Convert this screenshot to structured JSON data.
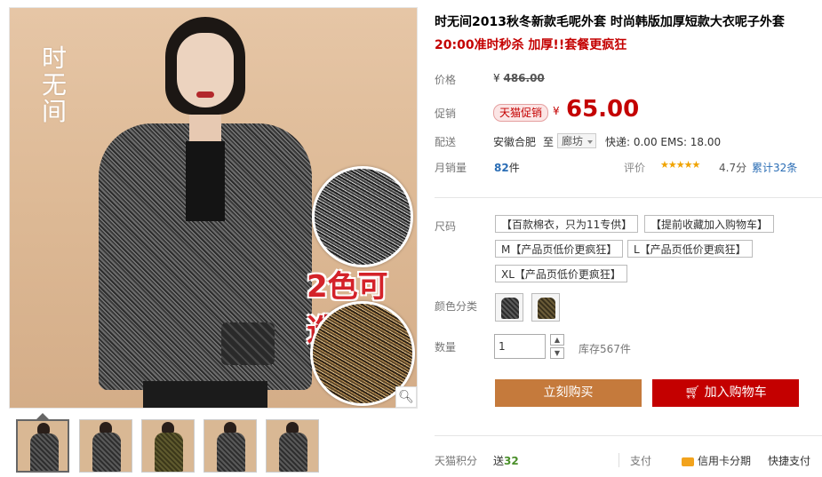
{
  "product": {
    "title": "时无间2013秋冬新款毛呢外套 时尚韩版加厚短款大衣呢子外套",
    "subtitle": "20:00准时秒杀 加厚!!套餐更疯狂",
    "brand_logo_text": "时无间",
    "image_overlay_text": "2色可选"
  },
  "price": {
    "label": "价格",
    "currency": "¥",
    "original": "486.00"
  },
  "promo": {
    "label": "促销",
    "badge": "天猫促销",
    "currency": "¥",
    "price": "65.00"
  },
  "shipping": {
    "label": "配送",
    "from": "安徽合肥",
    "to_word": "至",
    "destination": "廊坊",
    "fees": "快递: 0.00 EMS: 18.00"
  },
  "sales": {
    "label": "月销量",
    "count": "82",
    "unit": "件",
    "rating_label": "评价",
    "stars": "★★★★★",
    "rating": "4.7分",
    "reviews": "累计32条"
  },
  "size": {
    "label": "尺码",
    "options": [
      "【百款棉衣，只为11专供】",
      "【提前收藏加入购物车】",
      "M【产品页低价更疯狂】",
      "L【产品页低价更疯狂】",
      "XL【产品页低价更疯狂】"
    ]
  },
  "color": {
    "label": "颜色分类",
    "options": [
      "grey-coat",
      "olive-coat"
    ]
  },
  "quantity": {
    "label": "数量",
    "value": "1",
    "stock": "库存567件"
  },
  "buttons": {
    "buy_now": "立刻购买",
    "add_to_cart": "加入购物车"
  },
  "footer": {
    "points_label": "天猫积分",
    "points_prefix": "送",
    "points_value": "32",
    "pay_label": "支付",
    "credit_card": "信用卡分期",
    "quick_pay": "快捷支付"
  },
  "colors": {
    "accent_red": "#c40000",
    "buy_orange": "#c57a3c",
    "star": "#f0a300"
  }
}
